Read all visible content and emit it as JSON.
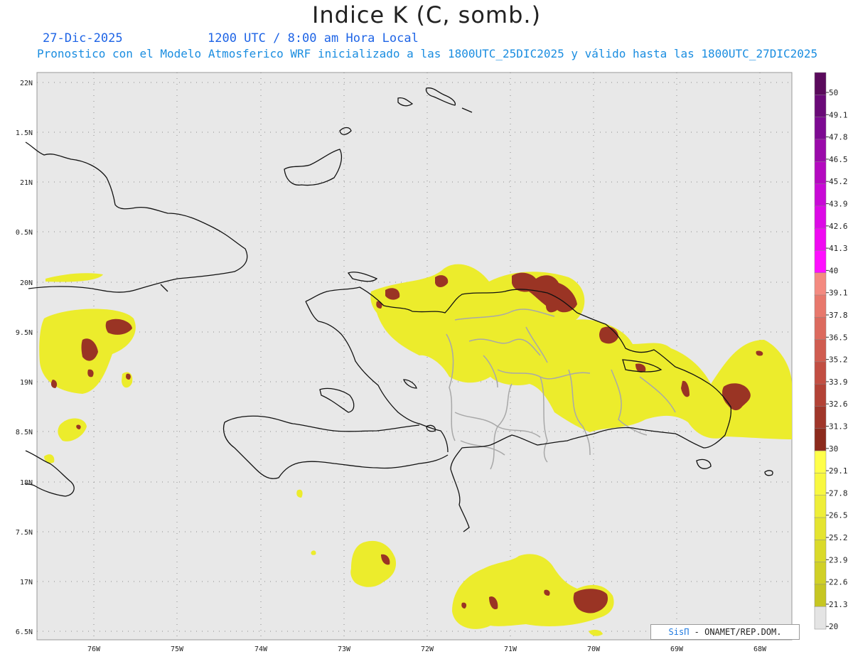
{
  "header": {
    "title": "Indice K (C, somb.)",
    "date": "27-Dic-2025",
    "time": "1200 UTC / 8:00 am Hora Local",
    "description": "Pronostico con el Modelo Atmosferico WRF inicializado a las 1800UTC_25DIC2025 y válido hasta las  1800UTC_27DIC2025"
  },
  "map": {
    "lat_labels": [
      "22N",
      "1.5N",
      "21N",
      "0.5N",
      "20N",
      "9.5N",
      "19N",
      "8.5N",
      "18N",
      "7.5N",
      "17N",
      "6.5N"
    ],
    "lon_labels": [
      "76W",
      "75W",
      "74W",
      "73W",
      "72W",
      "71W",
      "70W",
      "69W",
      "68W"
    ],
    "colors": {
      "background": "#e8e8e8",
      "coast": "#111111",
      "borders": "#aaaaaa",
      "grid": "#8c8c8c"
    }
  },
  "colorbar": {
    "labels": [
      "50",
      "49.1",
      "47.8",
      "46.5",
      "45.2",
      "43.9",
      "42.6",
      "41.3",
      "40",
      "39.1",
      "37.8",
      "36.5",
      "35.2",
      "33.9",
      "32.6",
      "31.3",
      "30",
      "29.1",
      "27.8",
      "26.5",
      "25.2",
      "23.9",
      "22.6",
      "21.3",
      "20"
    ],
    "colors": [
      "#5a0a5c",
      "#6a0a78",
      "#7d0a92",
      "#9a0aaa",
      "#b40ac0",
      "#c80ad6",
      "#dc0ae6",
      "#f00af2",
      "#ff10ff",
      "#f48a80",
      "#e8786c",
      "#dc6a5e",
      "#d05c50",
      "#c24e42",
      "#b34236",
      "#a0362a",
      "#8c2a1c",
      "#ffff4a",
      "#f8f840",
      "#eeee38",
      "#e4e430",
      "#dada2a",
      "#d0d026",
      "#c6c622",
      "#e4e4e4"
    ]
  },
  "credit": {
    "brand": "SisΠ",
    "text": "- ONAMET/REP.DOM."
  }
}
